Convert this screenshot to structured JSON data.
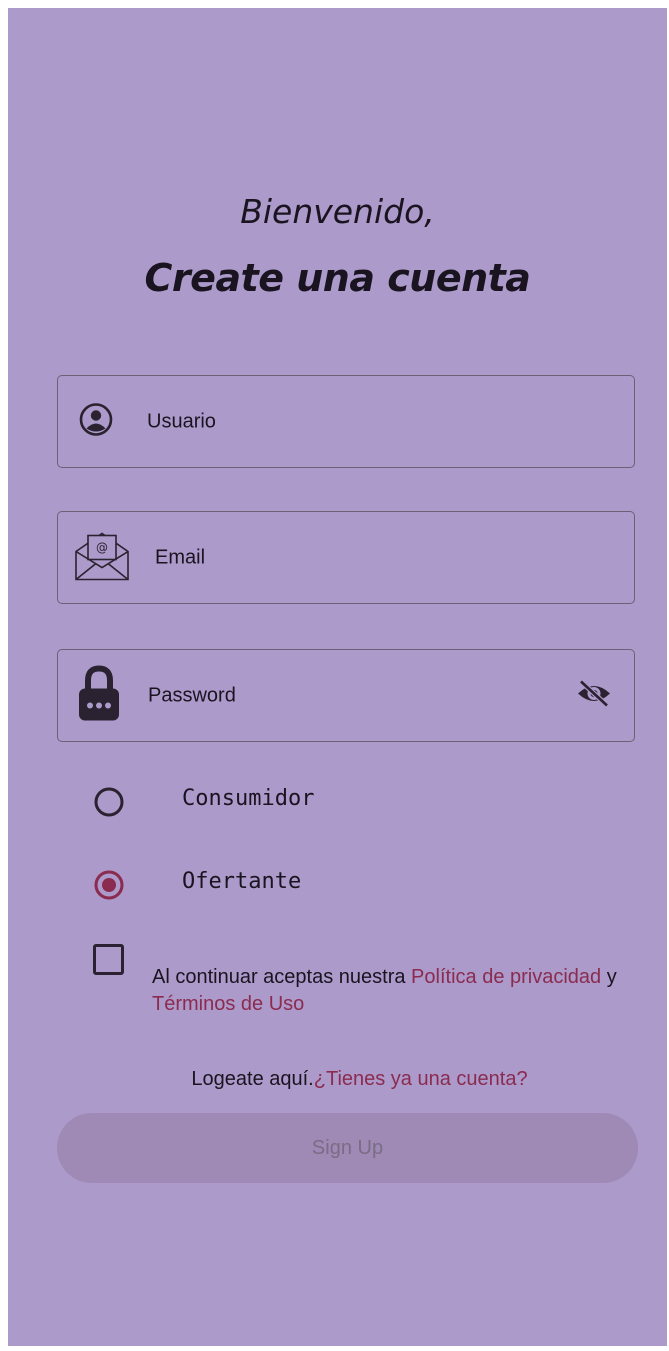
{
  "header": {
    "greeting": "Bienvenido,",
    "title": "Create una cuenta"
  },
  "form": {
    "username_placeholder": "Usuario",
    "email_placeholder": "Email",
    "password_placeholder": "Password"
  },
  "role": {
    "options": [
      "Consumidor",
      "Ofertante"
    ],
    "selected": "Ofertante"
  },
  "terms": {
    "checked": false,
    "prefix": "Al continuar aceptas nuestra ",
    "privacy_link": "Política de privacidad",
    "conjunction": " y ",
    "terms_link": "Términos de Uso"
  },
  "login": {
    "prefix": "Logeate aquí.",
    "link": "¿Tienes ya una cuenta?"
  },
  "actions": {
    "signup_label": "Sign Up"
  },
  "colors": {
    "background": "#ac9aca",
    "accent": "#8b2b4f",
    "button": "#9f89b5"
  },
  "icons": [
    "user-circle-icon",
    "envelope-icon",
    "lock-icon",
    "eye-off-icon",
    "radio-unchecked-icon",
    "radio-checked-icon",
    "checkbox-icon"
  ]
}
